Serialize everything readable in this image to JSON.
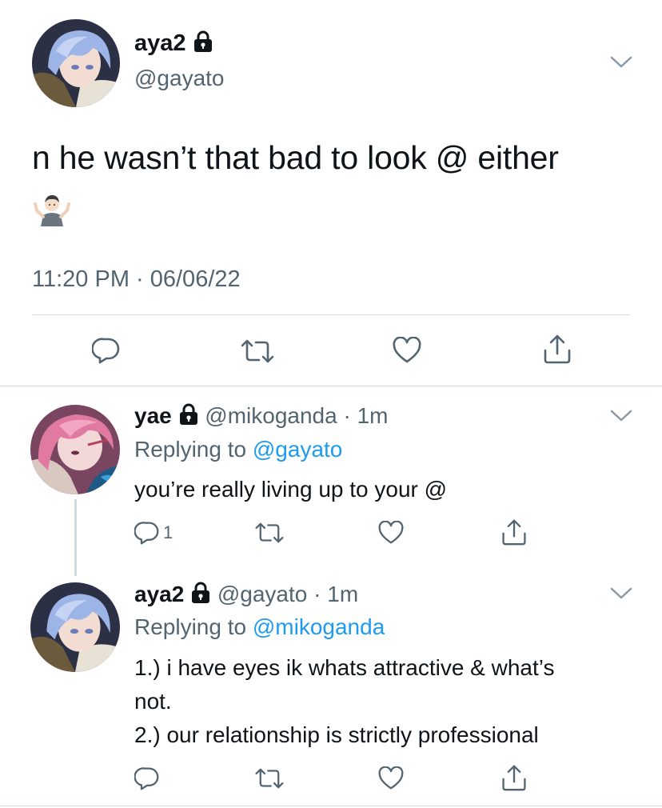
{
  "main_tweet": {
    "display_name": "aya2",
    "handle": "@gayato",
    "text": "n he wasn’t that bad to look @ either",
    "emoji": "person-shrugging",
    "timestamp": "11:20 PM · 06/06/22",
    "icons": [
      "lock-icon",
      "chevron-down-icon",
      "reply-icon",
      "retweet-icon",
      "like-icon",
      "share-icon"
    ]
  },
  "replies": [
    {
      "display_name": "yae",
      "handle": "@mikoganda",
      "time": "· 1m",
      "replying_prefix": "Replying to ",
      "replying_to": "@gayato",
      "text": "you’re really living up to your @",
      "reply_count": "1"
    },
    {
      "display_name": "aya2",
      "handle": "@gayato",
      "time": "· 1m",
      "replying_prefix": "Replying to ",
      "replying_to": "@mikoganda",
      "text_line1": "1.) i have eyes ik whats attractive & what’s",
      "text_line2": "not.",
      "text_line3": "2.) our relationship is strictly professional",
      "reply_count": ""
    }
  ],
  "colors": {
    "primary_text": "#0f1419",
    "secondary_text": "#536471",
    "link": "#1d9bf0",
    "divider": "#cfd9de"
  }
}
